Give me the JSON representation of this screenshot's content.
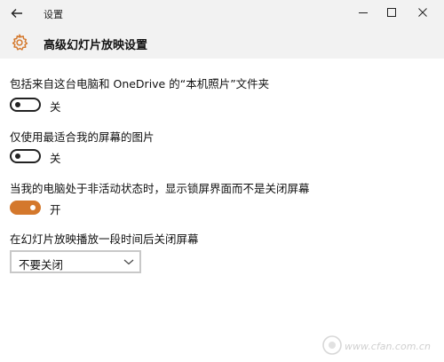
{
  "window": {
    "title": "设置"
  },
  "header": {
    "title": "高级幻灯片放映设置"
  },
  "settings": [
    {
      "label": "包括来自这台电脑和 OneDrive 的“本机照片”文件夹",
      "state": "关"
    },
    {
      "label": "仅使用最适合我的屏幕的图片",
      "state": "关"
    },
    {
      "label": "当我的电脑处于非活动状态时，显示锁屏界面而不是关闭屏幕",
      "state": "开"
    },
    {
      "label": "在幻灯片放映播放一段时间后关闭屏幕",
      "value": "不要关闭"
    }
  ],
  "colors": {
    "accent": "#d4782c",
    "titlebar": "#f2f2f2"
  },
  "icons": [
    "back-arrow-icon",
    "minimize-icon",
    "maximize-icon",
    "close-icon",
    "gear-icon",
    "chevron-down-icon"
  ],
  "watermark": "www.cfan.com.cn"
}
